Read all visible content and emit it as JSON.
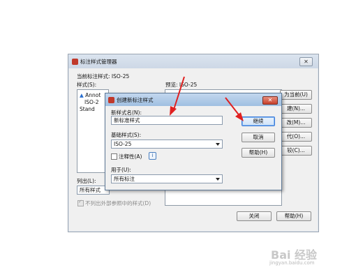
{
  "main_dialog": {
    "title": "标注样式管理器",
    "current_style_label": "当前标注样式:",
    "current_style_value": "ISO-25",
    "styles_label": "样式(S):",
    "preview_label": "预览:",
    "preview_value": "ISO-25",
    "styles_list": [
      "Annot",
      "ISO-2",
      "Stand"
    ],
    "buttons": [
      "置为当前(U)",
      "新建(N)...",
      "修改(M)...",
      "替代(O)...",
      "比较(C)..."
    ],
    "buttons_visible": [
      "为当前(U)",
      "建(N)...",
      "改(M)...",
      "代(O)...",
      "较(C)..."
    ],
    "list_label": "列出(L):",
    "list_value": "所有样式",
    "exclude_xref_label": "不列出外部参照中的样式(D)",
    "close_button": "关闭",
    "help_button": "帮助(H)"
  },
  "sub_dialog": {
    "title": "创建新标注样式",
    "new_name_label": "新样式名(N):",
    "new_name_value": "新标准样式",
    "based_on_label": "基础样式(S):",
    "based_on_value": "ISO-25",
    "annotative_label": "注释性(A)",
    "use_for_label": "用于(U):",
    "use_for_value": "所有标注",
    "continue_button": "继续",
    "cancel_button": "取消",
    "help_button": "帮助(H)"
  },
  "watermark": {
    "brand": "Bai 经验",
    "url": "jingyan.baidu.com"
  },
  "colors": {
    "annotation_arrow": "#e02020",
    "title_blue": "#9fbfe1",
    "close_red": "#c7402c"
  }
}
